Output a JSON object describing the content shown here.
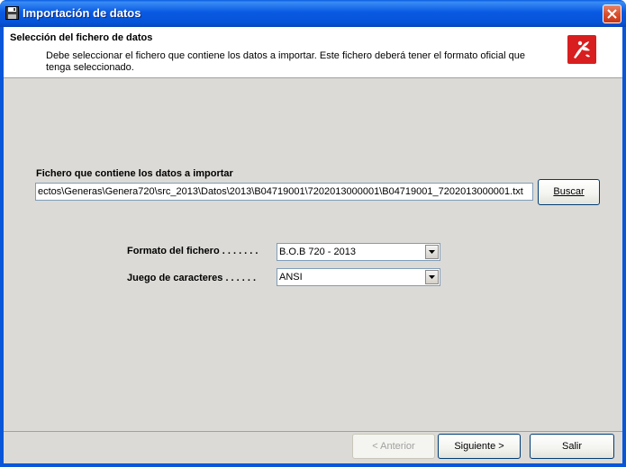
{
  "window": {
    "title": "Importación de datos",
    "close_label": "×"
  },
  "header": {
    "title": "Selección del fichero de datos",
    "description": "Debe seleccionar el fichero que contiene los datos a importar. Este fichero deberá tener el formato oficial que tenga seleccionado.",
    "logo_icon": "agencia-tributaria-logo-icon"
  },
  "file": {
    "label": "Fichero que contiene los datos a importar",
    "path": "ectos\\Generas\\Genera720\\src_2013\\Datos\\2013\\B04719001\\7202013000001\\B04719001_7202013000001.txt",
    "browse_label": "Buscar"
  },
  "format": {
    "label": "Formato del fichero . . . . . . .",
    "selected": "B.O.B 720 - 2013"
  },
  "charset": {
    "label": "Juego de caracteres . . . . . .",
    "selected": "ANSI"
  },
  "navigation": {
    "back_label": "< Anterior",
    "next_label": "Siguiente >",
    "exit_label": "Salir"
  },
  "colors": {
    "titlebar": "#0553d6",
    "accent_red": "#d81e1e"
  }
}
